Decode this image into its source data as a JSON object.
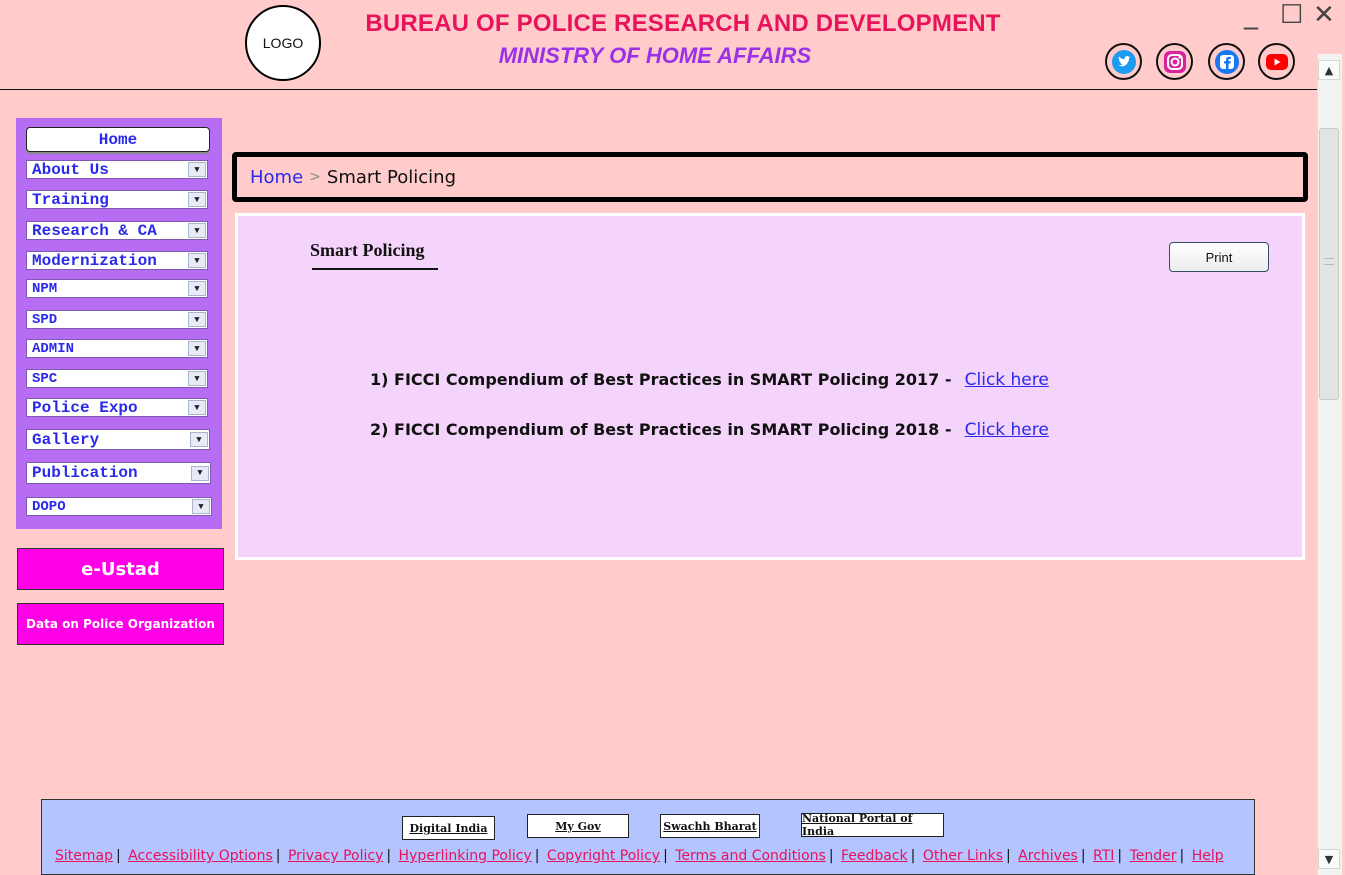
{
  "header": {
    "logo_text": "LOGO",
    "title": "BUREAU OF POLICE RESEARCH AND DEVELOPMENT",
    "subtitle": "MINISTRY OF HOME AFFAIRS",
    "social_icons": [
      "twitter-icon",
      "instagram-icon",
      "facebook-icon",
      "youtube-icon"
    ],
    "colors": {
      "title": "#e8135a",
      "subtitle": "#9b31e6",
      "background": "#ffcccb"
    }
  },
  "window_controls": {
    "minimize": "_",
    "maximize": "☐",
    "close": "✕"
  },
  "sidebar": {
    "home_label": "Home",
    "menu_items": [
      {
        "label": "About Us"
      },
      {
        "label": "Training"
      },
      {
        "label": "Research & CA"
      },
      {
        "label": "Modernization"
      },
      {
        "label": "NPM"
      },
      {
        "label": "SPD"
      },
      {
        "label": "ADMIN"
      },
      {
        "label": "SPC"
      },
      {
        "label": "Police Expo"
      },
      {
        "label": "Gallery"
      },
      {
        "label": "Publication"
      },
      {
        "label": "DOPO"
      }
    ],
    "e_ustad_label": "e-Ustad",
    "data_on_police_label": "Data on Police Organization",
    "colors": {
      "menu_bg": "#b66df4",
      "pink_button": "#ff00e6"
    }
  },
  "breadcrumb": {
    "home": "Home",
    "separator": ">",
    "current": "Smart Policing"
  },
  "content": {
    "title": "Smart Policing",
    "print_label": "Print",
    "documents": [
      {
        "text": "1) FICCI Compendium of Best Practices in SMART Policing 2017 -",
        "link": "Click here"
      },
      {
        "text": "2) FICCI Compendium of Best Practices in SMART Policing 2018 -",
        "link": "Click here"
      }
    ]
  },
  "footer": {
    "buttons": [
      "Digital India",
      "My Gov",
      "Swachh Bharat",
      "National Portal of India"
    ],
    "links": [
      "Sitemap",
      "Accessibility Options",
      "Privacy Policy",
      "Hyperlinking Policy",
      "Copyright Policy",
      "Terms and Conditions",
      "Feedback",
      "Other Links",
      "Archives",
      "RTI",
      "Tender",
      "Help"
    ]
  }
}
